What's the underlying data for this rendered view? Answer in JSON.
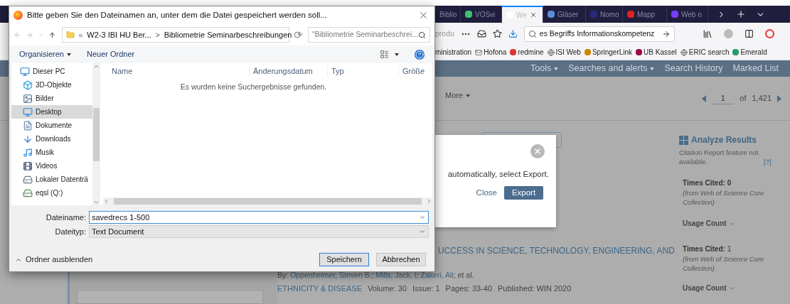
{
  "browser": {
    "tabs": [
      {
        "label": "Biblio",
        "selected": false
      },
      {
        "label": "VOSvi",
        "selected": false
      },
      {
        "label": "We",
        "selected": true
      },
      {
        "label": "Gläser",
        "selected": false
      },
      {
        "label": "Nomo",
        "selected": false
      },
      {
        "label": "Mapp",
        "selected": false
      },
      {
        "label": "Web o",
        "selected": false
      }
    ],
    "url_prefix": "produ",
    "url": "es Begriffs Informationskompetenz",
    "bookmarks": [
      {
        "label": "ministration"
      },
      {
        "label": "Hofona"
      },
      {
        "label": "redmine"
      },
      {
        "label": "ISI Web"
      },
      {
        "label": "SpringerLink"
      },
      {
        "label": "UB Kassel"
      },
      {
        "label": "ERIC search"
      },
      {
        "label": "Emerald"
      }
    ]
  },
  "site_nav": [
    {
      "label": "Tools",
      "dropdown": true
    },
    {
      "label": "Searches and alerts",
      "dropdown": true
    },
    {
      "label": "Search History",
      "dropdown": false
    },
    {
      "label": "Marked List",
      "dropdown": false
    }
  ],
  "results": {
    "more": "More",
    "page": "1",
    "of": "of",
    "total": "1,421",
    "record_title": "UCCESS IN SCIENCE, TECHNOLOGY, ENGINEERING, AND",
    "by": "By:",
    "authors": [
      {
        "name": "Oppenheimer, Steven B.",
        "sep": ";"
      },
      {
        "name": "Mills, Jack, I",
        "sep": ";"
      },
      {
        "name": "Zakeri, Ali",
        "sep": ";"
      }
    ],
    "et_al": "et al.",
    "source": "ETHNICITY & DISEASE",
    "meta": [
      "Volume: 30",
      "Issue: 1",
      "Pages: 33-40",
      "Published: WIN 2020"
    ]
  },
  "sidebar": {
    "analyze": "Analyze Results",
    "note": "Citation Report feature not available.",
    "help": "[?]",
    "records": [
      {
        "label": "Times Cited:",
        "count": "0",
        "linked": false,
        "source": "(from Web of Science Core Collection)",
        "usage": "Usage Count"
      },
      {
        "label": "Times Cited:",
        "count": "1",
        "linked": true,
        "source": "(from Web of Science Core Collection)",
        "usage": "Usage Count"
      }
    ]
  },
  "export_modal": {
    "message": "automatically, select Export.",
    "close": "Close",
    "export": "Export"
  },
  "save_dialog": {
    "title": "Bitte geben Sie den Dateinamen an, unter dem die Datei gespeichert werden soll...",
    "breadcrumb_prefix": "«",
    "breadcrumb": [
      "W2-3 IBI HU Ber...",
      "Bibliometrie Seminarbeschreibungen"
    ],
    "breadcrumb_sep": ">",
    "search_placeholder": "\"Bibliometrie Seminarbeschrei...",
    "organize": "Organisieren",
    "new_folder": "Neuer Ordner",
    "tree": [
      {
        "label": "Dieser PC",
        "kind": "pc",
        "selected": false,
        "children": [
          {
            "label": "3D-Objekte",
            "kind": "objects",
            "selected": false
          },
          {
            "label": "Bilder",
            "kind": "pictures",
            "selected": false
          },
          {
            "label": "Desktop",
            "kind": "desktop",
            "selected": true
          },
          {
            "label": "Dokumente",
            "kind": "documents",
            "selected": false
          },
          {
            "label": "Downloads",
            "kind": "downloads",
            "selected": false
          },
          {
            "label": "Musik",
            "kind": "music",
            "selected": false
          },
          {
            "label": "Videos",
            "kind": "videos",
            "selected": false
          },
          {
            "label": "Lokaler Datenträ",
            "kind": "drive",
            "selected": false
          },
          {
            "label": "eqsl (Q:)",
            "kind": "netdrive",
            "selected": false
          }
        ]
      }
    ],
    "columns": [
      "Name",
      "Änderungsdatum",
      "Typ",
      "Größe"
    ],
    "empty_message": "Es wurden keine Suchergebnisse gefunden.",
    "filename_label": "Dateiname:",
    "filename": "savedrecs 1-500",
    "filetype_label": "Dateityp:",
    "filetype": "Text Document",
    "hide_folders": "Ordner ausblenden",
    "save": "Speichern",
    "cancel": "Abbrechen"
  }
}
